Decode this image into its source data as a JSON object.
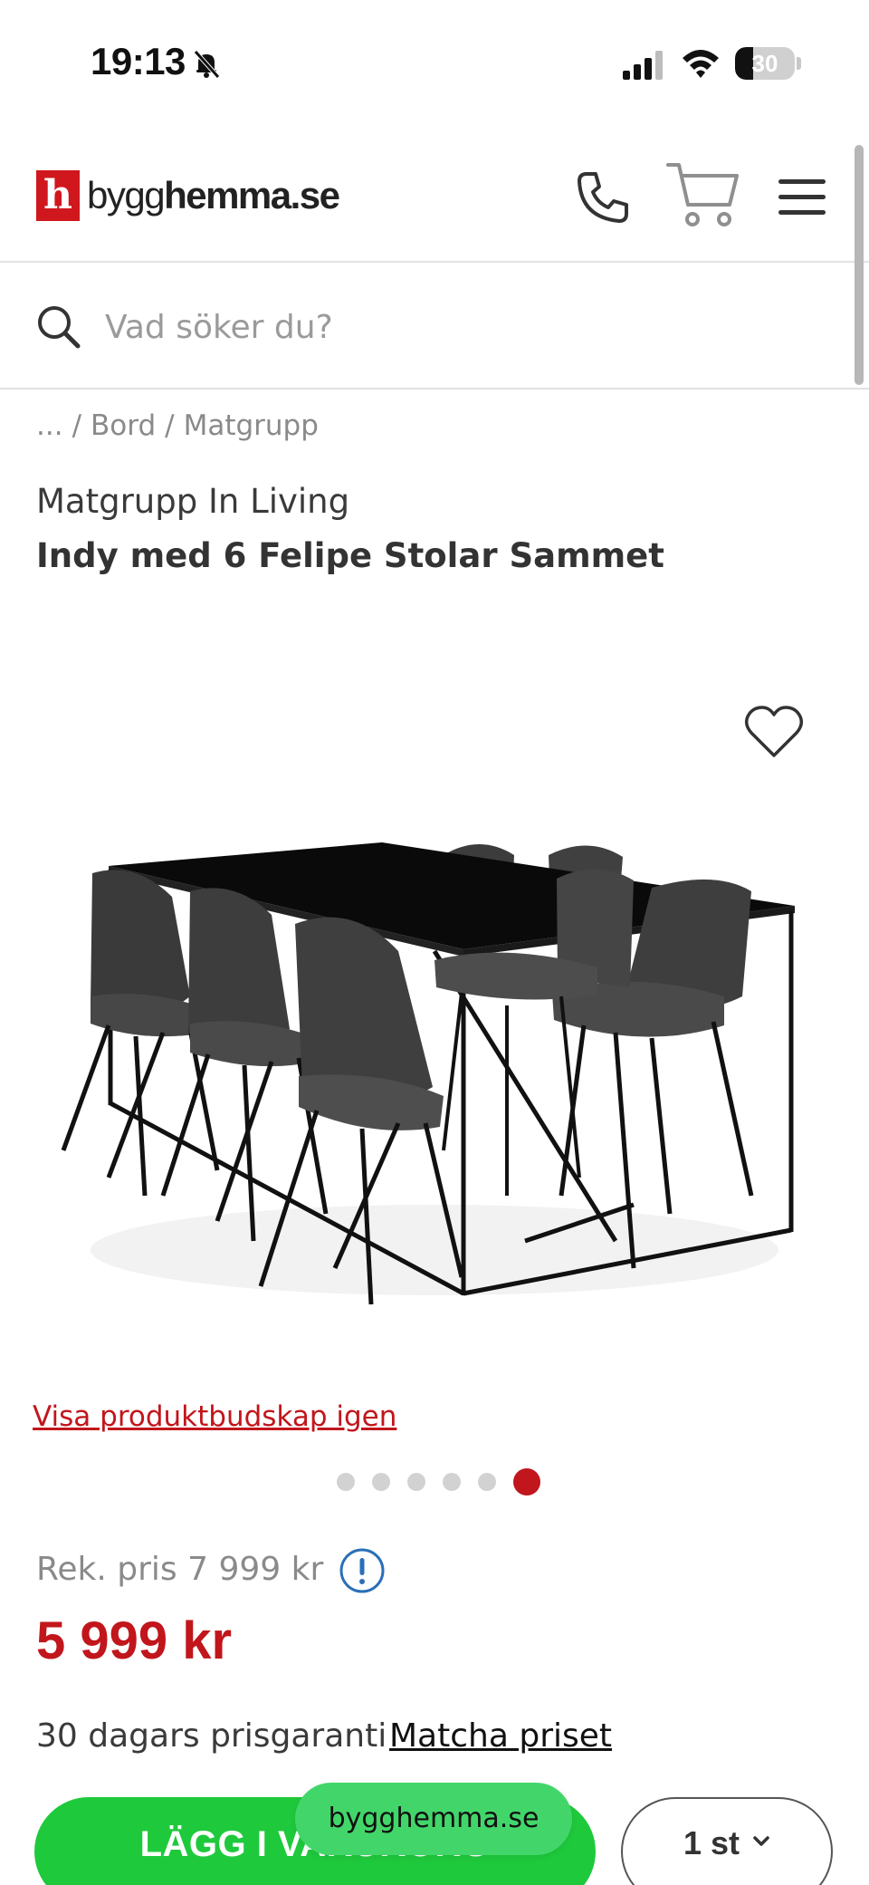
{
  "status_bar": {
    "time": "19:13",
    "battery": "30",
    "battery_level": 0.3,
    "icons": [
      "bell-slash-icon",
      "signal-icon",
      "wifi-icon",
      "battery-icon"
    ]
  },
  "header": {
    "logo_mark": "h",
    "logo_text_light": "bygg",
    "logo_text_bold": "hemma",
    "logo_text_suffix": ".se",
    "icons": [
      "phone-icon",
      "cart-icon",
      "menu-icon"
    ],
    "brand_color": "#d0171d"
  },
  "search": {
    "placeholder": "Vad söker du?",
    "value": ""
  },
  "breadcrumb": {
    "ellipsis": "...",
    "separator": "/",
    "items": [
      "Bord",
      "Matgrupp"
    ]
  },
  "product": {
    "brand": "Matgrupp In Living",
    "title": "Indy med 6 Felipe Stolar Sammet",
    "reshow_link": "Visa produktbudskap igen",
    "image_count": 6,
    "active_image_index": 5,
    "recommended_price": "Rek. pris 7 999 kr",
    "price": "5 999 kr",
    "price_guarantee": "30 dagars prisgaranti",
    "match_price_link": "Matcha priset",
    "accent_color": "#c1161c"
  },
  "actions": {
    "add_to_cart": "LÄGG I VARUKORG",
    "quantity": "1 st",
    "toast": "bygghemma.se",
    "button_color": "#1fc93c"
  }
}
